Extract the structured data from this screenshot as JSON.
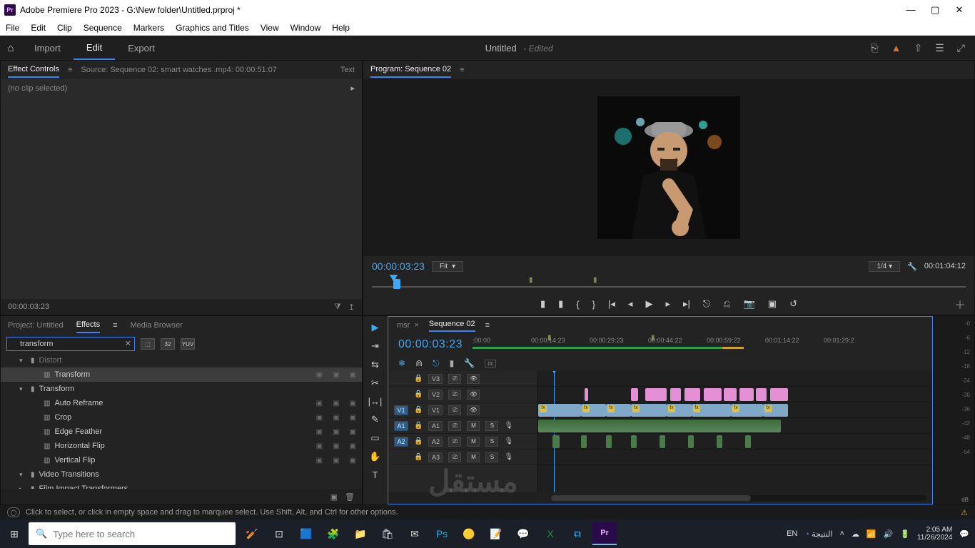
{
  "window": {
    "title": "Adobe Premiere Pro 2023 - G:\\New folder\\Untitled.prproj *",
    "app_badge": "Pr"
  },
  "menu": [
    "File",
    "Edit",
    "Clip",
    "Sequence",
    "Markers",
    "Graphics and Titles",
    "View",
    "Window",
    "Help"
  ],
  "workspace": {
    "links": [
      "Import",
      "Edit",
      "Export"
    ],
    "active": "Edit",
    "doc_title": "Untitled",
    "doc_state": "- Edited"
  },
  "effect_controls": {
    "tab": "Effect Controls",
    "source_label": "Source: Sequence 02: smart watches .mp4: 00:00:51:07",
    "text_tab": "Text",
    "no_clip": "(no clip selected)",
    "tc": "00:00:03:23"
  },
  "program": {
    "tab": "Program: Sequence 02",
    "tc": "00:00:03:23",
    "fit": "Fit",
    "resolution": "1/4",
    "duration": "00:01:04:12"
  },
  "project_panel": {
    "tabs": [
      "Project: Untitled",
      "Effects",
      "Media Browser"
    ],
    "active_tab": "Effects",
    "search_value": "transform",
    "badges": [
      "⬚",
      "32",
      "YUV"
    ],
    "tree": [
      {
        "level": 1,
        "disc": "▾",
        "type": "folder",
        "label": "Distort",
        "dim": true
      },
      {
        "level": 2,
        "disc": "",
        "type": "preset",
        "label": "Transform",
        "selected": true,
        "badge": true
      },
      {
        "level": 1,
        "disc": "▾",
        "type": "folder",
        "label": "Transform"
      },
      {
        "level": 2,
        "disc": "",
        "type": "preset",
        "label": "Auto Reframe",
        "badge": true
      },
      {
        "level": 2,
        "disc": "",
        "type": "preset",
        "label": "Crop",
        "badge": true
      },
      {
        "level": 2,
        "disc": "",
        "type": "preset",
        "label": "Edge Feather",
        "badge": true
      },
      {
        "level": 2,
        "disc": "",
        "type": "preset",
        "label": "Horizontal Flip",
        "badge": true
      },
      {
        "level": 2,
        "disc": "",
        "type": "preset",
        "label": "Vertical Flip",
        "badge": true
      },
      {
        "level": 1,
        "disc": "▾",
        "type": "folder",
        "label": "Video Transitions"
      },
      {
        "level": 1,
        "disc": "▸",
        "type": "folder",
        "label": "Film Impact Transformers",
        "ind": "ind1"
      }
    ]
  },
  "timeline": {
    "tabs": [
      {
        "label": "msr",
        "active": false
      },
      {
        "label": "Sequence 02",
        "active": true
      }
    ],
    "tc": "00:00:03:23",
    "ruler_ticks": [
      ":00:00",
      "00:00:14:23",
      "00:00:29:23",
      "00:00:44:22",
      "00:00:59:22",
      "00:01:14:22",
      "00:01:29:2"
    ],
    "tracks": {
      "video": [
        {
          "id": "V3",
          "sel": false
        },
        {
          "id": "V2",
          "sel": false
        },
        {
          "id": "V1",
          "sel": true
        }
      ],
      "audio": [
        {
          "id": "A1",
          "sel": true
        },
        {
          "id": "A2",
          "sel": true
        },
        {
          "id": "A3",
          "sel": false
        }
      ]
    },
    "track_btns": {
      "mute": "M",
      "solo": "S"
    }
  },
  "meters_scale": [
    "-0",
    "-6",
    "-12",
    "-18",
    "-24",
    "-30",
    "-36",
    "-42",
    "-48",
    "-54"
  ],
  "status": {
    "hint": "Click to select, or click in empty space and drag to marquee select. Use Shift, Alt, and Ctrl for other options."
  },
  "taskbar": {
    "search_placeholder": "Type here to search",
    "lang": "EN",
    "weather": "النتيجة",
    "time": "2:05 AM",
    "date": "11/26/2024"
  },
  "watermark": "مستقل"
}
